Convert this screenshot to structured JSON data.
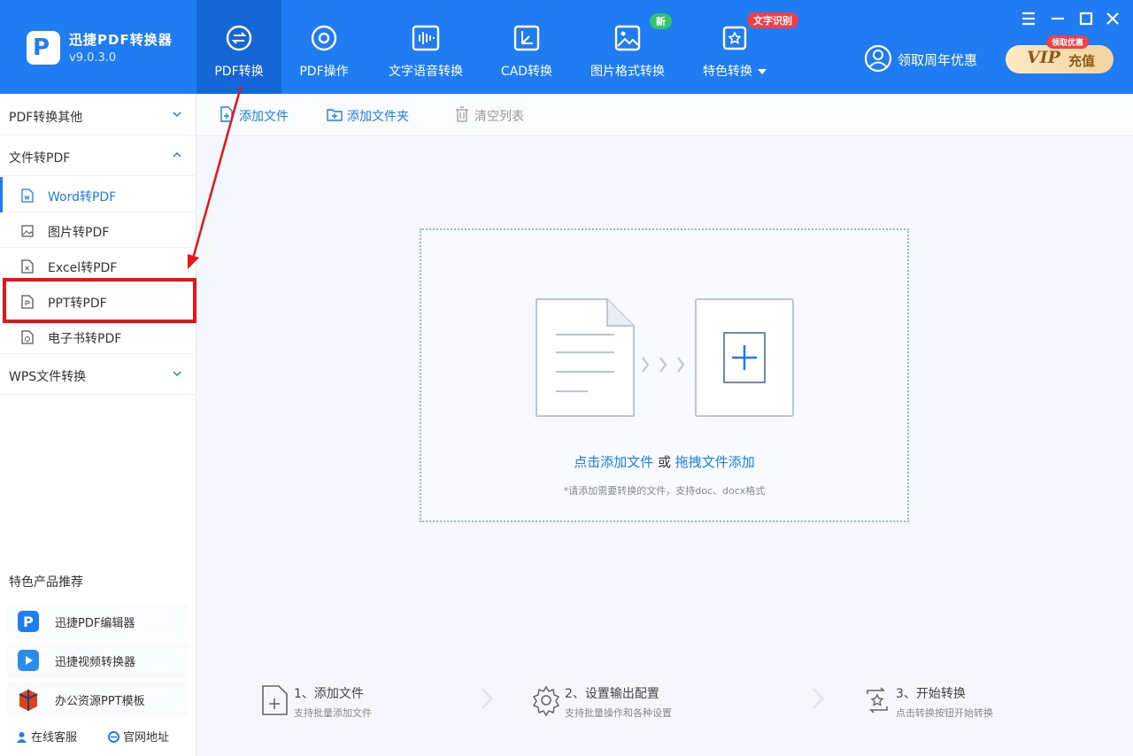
{
  "app": {
    "name": "迅捷PDF转换器",
    "version": "v9.0.3.0",
    "logo_letter": "P"
  },
  "nav": {
    "tabs": [
      {
        "label": "PDF转换",
        "icon": "convert-icon",
        "active": true
      },
      {
        "label": "PDF操作",
        "icon": "disc-icon"
      },
      {
        "label": "文字语音转换",
        "icon": "voice-wave-icon"
      },
      {
        "label": "CAD转换",
        "icon": "cad-icon"
      },
      {
        "label": "图片格式转换",
        "icon": "image-icon"
      },
      {
        "label": "特色转换",
        "icon": "special-convert-icon"
      }
    ],
    "badge_new": "新",
    "badge_ocr": "文字识别"
  },
  "promo": {
    "label": "领取周年优惠",
    "icon": "user-circle-icon"
  },
  "vip": {
    "label": "VIP",
    "action": "充值",
    "badge": "领取优惠"
  },
  "window_controls": [
    "menu-icon",
    "minimize-icon",
    "maximize-icon",
    "close-icon"
  ],
  "sidebar": {
    "groups": [
      {
        "label": "PDF转换其他",
        "expanded": false
      },
      {
        "label": "文件转PDF",
        "expanded": true
      },
      {
        "label": "WPS文件转换",
        "expanded": false
      }
    ],
    "items": [
      {
        "label": "Word转PDF",
        "active": true
      },
      {
        "label": "图片转PDF"
      },
      {
        "label": "Excel转PDF"
      },
      {
        "label": "PPT转PDF",
        "highlighted": true
      },
      {
        "label": "电子书转PDF"
      }
    ],
    "recommend_title": "特色产品推荐",
    "recommend": [
      {
        "label": "迅捷PDF编辑器",
        "icon": "pdf-editor-icon"
      },
      {
        "label": "迅捷视频转换器",
        "icon": "video-converter-icon"
      },
      {
        "label": "办公资源PPT模板",
        "icon": "ppt-template-icon"
      }
    ],
    "footer": {
      "service": "在线客服",
      "website": "官网地址"
    }
  },
  "toolbar": {
    "add_file": "添加文件",
    "add_folder": "添加文件夹",
    "clear_list": "清空列表"
  },
  "dropzone": {
    "click_add": "点击添加文件",
    "or": " 或 ",
    "drag_add": "拖拽文件添加",
    "hint": "*请添加需要转换的文件，支持doc、docx格式"
  },
  "steps": [
    {
      "title": "1、添加文件",
      "desc": "支持批量添加文件"
    },
    {
      "title": "2、设置输出配置",
      "desc": "支持批量操作和各种设置"
    },
    {
      "title": "3、开始转换",
      "desc": "点击转换按钮开始转换"
    }
  ],
  "colors": {
    "brand": "#1f7cf2",
    "highlight": "#e8141c",
    "badge_new": "#35c26b",
    "badge_ocr": "#ef3f4b"
  }
}
